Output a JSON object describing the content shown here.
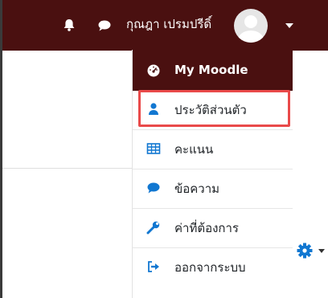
{
  "navbar": {
    "notifications_icon": "bell-icon",
    "messages_icon": "chat-bubble-icon",
    "user_name": "กุณฎา เปรมปรีดิ์",
    "avatar": "default-user-avatar",
    "menu_toggle_icon": "caret-down-icon",
    "background_color": "#4a1010"
  },
  "user_menu": {
    "items": [
      {
        "label": "My Moodle",
        "icon": "dashboard-icon",
        "active": true
      },
      {
        "label": "ประวัติส่วนตัว",
        "icon": "user-icon",
        "highlighted": true
      },
      {
        "label": "คะแนน",
        "icon": "table-icon"
      },
      {
        "label": "ข้อความ",
        "icon": "chat-bubble-icon"
      },
      {
        "label": "ค่าที่ต้องการ",
        "icon": "wrench-icon"
      },
      {
        "label": "ออกจากระบบ",
        "icon": "sign-out-icon"
      }
    ],
    "accent_color": "#1177d1",
    "highlight_color": "#e94a4a"
  },
  "page": {
    "settings_icon": "gear-icon"
  }
}
